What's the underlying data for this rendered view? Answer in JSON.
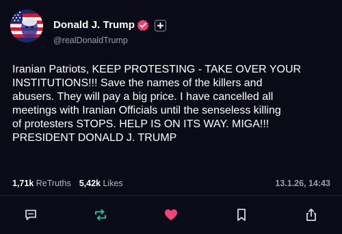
{
  "author": {
    "display_name": "Donald J. Trump",
    "handle": "@realDonaldTrump",
    "avatar_icon": "american-flag-portrait-avatar",
    "verified_icon": "verified-badge-icon",
    "follow_icon": "plus-icon"
  },
  "post": {
    "lines": [
      "Iranian Patriots, KEEP PROTESTING - TAKE OVER YOUR",
      "INSTITUTIONS!!! Save the names of the killers and",
      "abusers. They will pay a big price. I have cancelled all",
      "meetings with Iranian Officials until the senseless killing",
      "of protesters STOPS. HELP IS ON ITS WAY. MIGA!!!",
      "PRESIDENT DONALD J. TRUMP"
    ]
  },
  "stats": {
    "retruths_count": "1,71k",
    "retruths_label": "ReTruths",
    "likes_count": "5,42k",
    "likes_label": "Likes"
  },
  "timestamp": "13.1.26, 14:43",
  "actions": {
    "reply_icon": "speech-bubble-icon",
    "retruth_icon": "repost-arrows-icon",
    "like_icon": "heart-icon",
    "bookmark_icon": "bookmark-icon",
    "share_icon": "share-icon"
  },
  "colors": {
    "background": "#0b0b17",
    "verified": "#e8446b",
    "retruth_accent": "#2fb897",
    "like_accent": "#f0457a",
    "muted_text": "#9c9cb0"
  }
}
